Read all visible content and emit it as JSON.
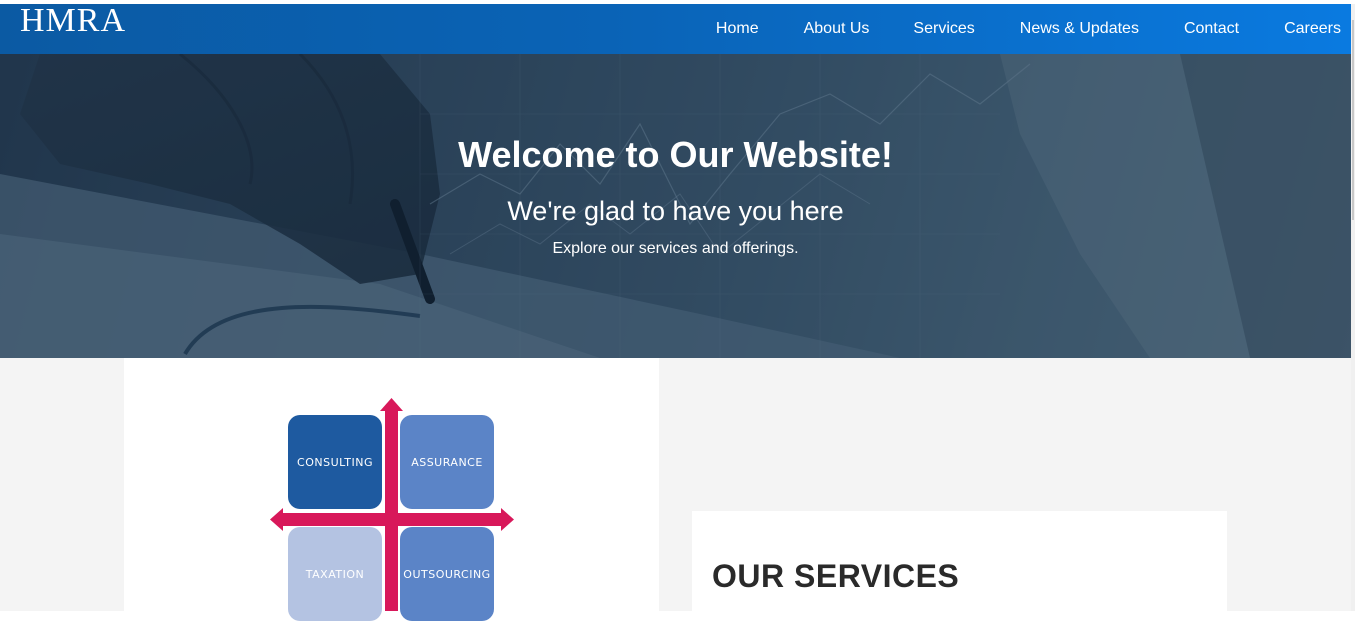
{
  "brand": {
    "logo": "HMRA"
  },
  "nav": {
    "items": [
      {
        "label": "Home"
      },
      {
        "label": "About Us"
      },
      {
        "label": "Services"
      },
      {
        "label": "News & Updates"
      },
      {
        "label": "Contact"
      },
      {
        "label": "Careers"
      }
    ]
  },
  "hero": {
    "title": "Welcome to Our Website!",
    "subtitle": "We're glad to have you here",
    "tagline": "Explore our services and offerings."
  },
  "diagram": {
    "quadrants": [
      "CONSULTING",
      "ASSURANCE",
      "TAXATION",
      "OUTSOURCING"
    ],
    "colors": {
      "consulting": "#1e5aa0",
      "assurance": "#5b84c7",
      "taxation": "#b4c3e2",
      "outsourcing": "#5b84c7",
      "arrows": "#d8185a"
    }
  },
  "services": {
    "heading": "OUR SERVICES"
  },
  "colors": {
    "nav_start": "#0b5aa3",
    "nav_end": "#0a7ae0",
    "section_bg": "#f4f4f4"
  }
}
